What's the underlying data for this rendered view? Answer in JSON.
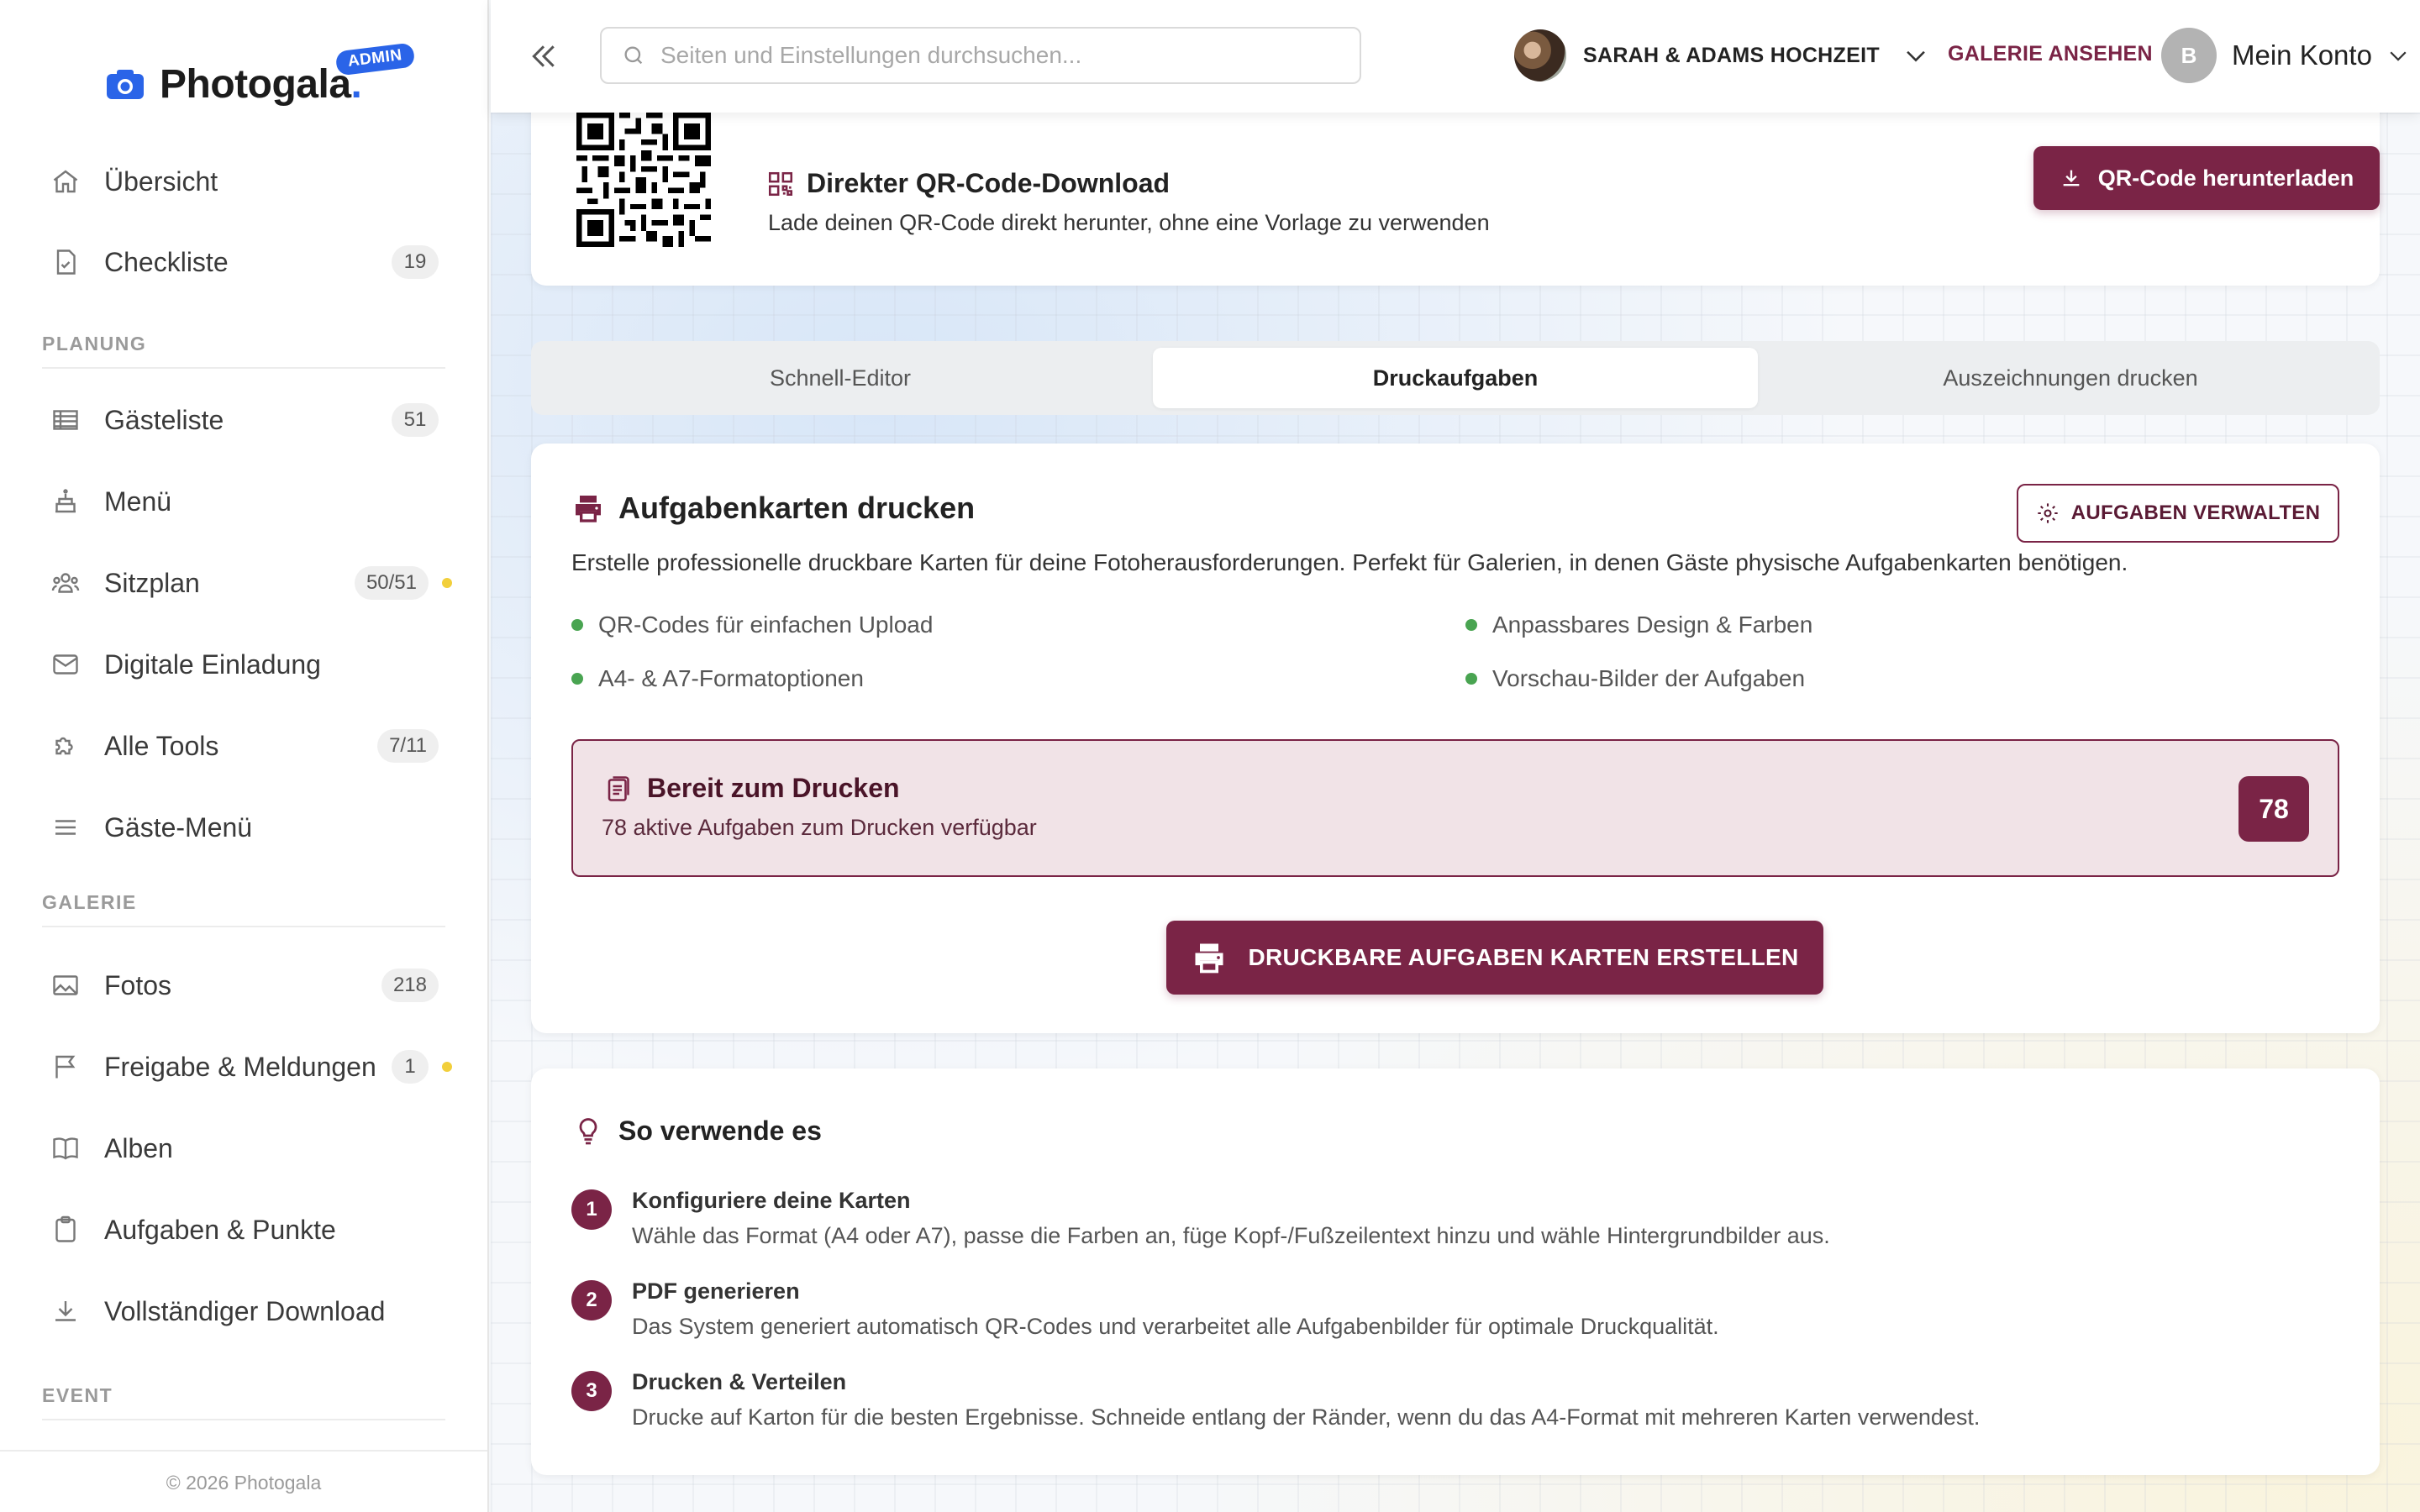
{
  "brand": {
    "name": "Photogala",
    "admin_badge": "ADMIN",
    "footer": "© 2026 Photogala"
  },
  "sidebar": {
    "items": [
      {
        "label": "Übersicht",
        "icon": "home-icon"
      },
      {
        "label": "Checkliste",
        "icon": "checklist-icon",
        "badge": "19"
      },
      {
        "section": "PLANUNG"
      },
      {
        "label": "Gästeliste",
        "icon": "table-icon",
        "badge": "51"
      },
      {
        "label": "Menü",
        "icon": "cake-icon"
      },
      {
        "label": "Sitzplan",
        "icon": "users-icon",
        "badge": "50/51",
        "dot": true
      },
      {
        "label": "Digitale Einladung",
        "icon": "mail-icon"
      },
      {
        "label": "Alle Tools",
        "icon": "puzzle-icon",
        "badge": "7/11"
      },
      {
        "label": "Gäste-Menü",
        "icon": "menu-icon"
      },
      {
        "section": "GALERIE"
      },
      {
        "label": "Fotos",
        "icon": "image-icon",
        "badge": "218"
      },
      {
        "label": "Freigabe & Meldungen",
        "icon": "flag-icon",
        "badge": "1",
        "dot": true
      },
      {
        "label": "Alben",
        "icon": "book-icon"
      },
      {
        "label": "Aufgaben & Punkte",
        "icon": "clipboard-icon"
      },
      {
        "label": "Vollständiger Download",
        "icon": "download-icon"
      },
      {
        "section": "EVENT"
      }
    ]
  },
  "topbar": {
    "search_placeholder": "Seiten und Einstellungen durchsuchen...",
    "event_name": "SARAH & ADAMS HOCHZEIT",
    "gallery_link": "GALERIE ANSEHEN",
    "account_initial": "B",
    "account_label": "Mein Konto"
  },
  "qr_card": {
    "title": "Direkter QR-Code-Download",
    "description": "Lade deinen QR-Code direkt herunter, ohne eine Vorlage zu verwenden",
    "button": "QR-Code herunterladen"
  },
  "tabs": [
    {
      "label": "Schnell-Editor",
      "active": false
    },
    {
      "label": "Druckaufgaben",
      "active": true
    },
    {
      "label": "Auszeichnungen drucken",
      "active": false
    }
  ],
  "print_card": {
    "title": "Aufgabenkarten drucken",
    "manage_button": "AUFGABEN VERWALTEN",
    "description": "Erstelle professionelle druckbare Karten für deine Fotoherausforderungen. Perfekt für Galerien, in denen Gäste physische Aufgabenkarten benötigen.",
    "features": [
      "QR-Codes für einfachen Upload",
      "Anpassbares Design & Farben",
      "A4- & A7-Formatoptionen",
      "Vorschau-Bilder der Aufgaben"
    ],
    "ready_title": "Bereit zum Drucken",
    "ready_sub": "78 aktive Aufgaben zum Drucken verfügbar",
    "ready_count": "78",
    "create_button": "DRUCKBARE AUFGABEN KARTEN ERSTELLEN"
  },
  "how_card": {
    "title": "So verwende es",
    "steps": [
      {
        "num": "1",
        "title": "Konfiguriere deine Karten",
        "text": "Wähle das Format (A4 oder A7), passe die Farben an, füge Kopf-/Fußzeilentext hinzu und wähle Hintergrundbilder aus."
      },
      {
        "num": "2",
        "title": "PDF generieren",
        "text": "Das System generiert automatisch QR-Codes und verarbeitet alle Aufgabenbilder für optimale Druckqualität."
      },
      {
        "num": "3",
        "title": "Drucken & Verteilen",
        "text": "Drucke auf Karton für die besten Ergebnisse. Schneide entlang der Ränder, wenn du das A4-Format mit mehreren Karten verwendest."
      }
    ]
  },
  "colors": {
    "accent": "#7a2446",
    "brand_blue": "#2a64e8",
    "bullet_green": "#49a451",
    "dot_yellow": "#f2cf3b"
  }
}
